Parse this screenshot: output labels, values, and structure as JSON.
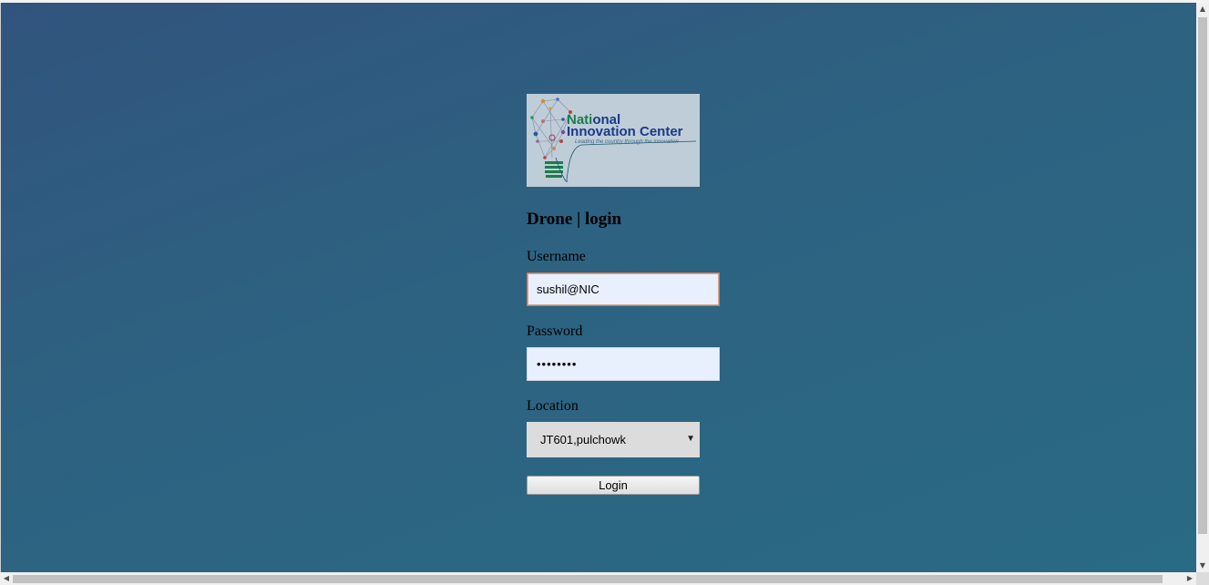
{
  "logo": {
    "title_line1_a": "Nati",
    "title_line1_b": "onal",
    "title_line2": "Innovation Center",
    "tagline": "Leading the country through the innovation"
  },
  "form": {
    "heading": "Drone | login",
    "username_label": "Username",
    "username_value": "sushil@NIC",
    "password_label": "Password",
    "password_value": "••••••••",
    "location_label": "Location",
    "location_selected": "JT601,pulchowk",
    "login_button": "Login"
  },
  "scrollbars": {
    "up": "▲",
    "down": "▼",
    "left": "◀",
    "right": "▶"
  },
  "colors": {
    "background_start": "#31547e",
    "background_end": "#296a84",
    "input_bg": "#e8f0fe"
  }
}
